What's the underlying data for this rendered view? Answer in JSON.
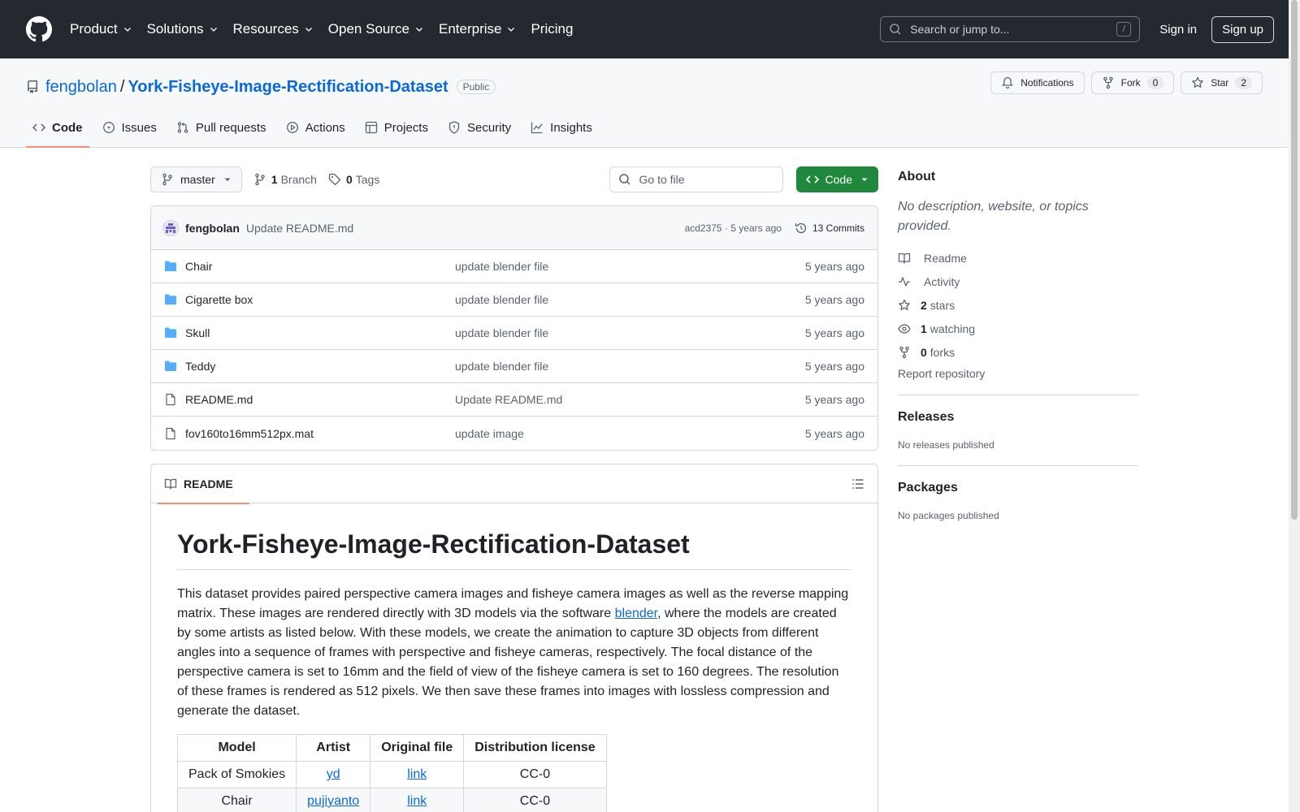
{
  "header": {
    "nav": [
      {
        "label": "Product",
        "dropdown": true
      },
      {
        "label": "Solutions",
        "dropdown": true
      },
      {
        "label": "Resources",
        "dropdown": true
      },
      {
        "label": "Open Source",
        "dropdown": true
      },
      {
        "label": "Enterprise",
        "dropdown": true
      },
      {
        "label": "Pricing",
        "dropdown": false
      }
    ],
    "search_placeholder": "Search or jump to...",
    "search_key": "/",
    "sign_in": "Sign in",
    "sign_up": "Sign up"
  },
  "repo": {
    "owner": "fengbolan",
    "separator": "/",
    "name": "York-Fisheye-Image-Rectification-Dataset",
    "visibility": "Public",
    "notifications_label": "Notifications",
    "fork_label": "Fork",
    "fork_count": "0",
    "star_label": "Star",
    "star_count": "2",
    "tabs": [
      {
        "label": "Code",
        "icon": "code-icon"
      },
      {
        "label": "Issues",
        "icon": "issue-icon"
      },
      {
        "label": "Pull requests",
        "icon": "pull-request-icon"
      },
      {
        "label": "Actions",
        "icon": "play-icon"
      },
      {
        "label": "Projects",
        "icon": "table-icon"
      },
      {
        "label": "Security",
        "icon": "shield-icon"
      },
      {
        "label": "Insights",
        "icon": "graph-icon"
      }
    ]
  },
  "toolbar": {
    "branch": "master",
    "branch_count": "1",
    "branch_label": "Branch",
    "tag_count": "0",
    "tag_label": "Tags",
    "goto_placeholder": "Go to file",
    "code_label": "Code"
  },
  "latest_commit": {
    "author": "fengbolan",
    "message": "Update README.md",
    "hash_time": "acd2375 · 5 years ago",
    "commits_label": "13 Commits"
  },
  "files": [
    {
      "type": "folder",
      "name": "Chair",
      "commit": "update blender file",
      "age": "5 years ago"
    },
    {
      "type": "folder",
      "name": "Cigarette box",
      "commit": "update blender file",
      "age": "5 years ago"
    },
    {
      "type": "folder",
      "name": "Skull",
      "commit": "update blender file",
      "age": "5 years ago"
    },
    {
      "type": "folder",
      "name": "Teddy",
      "commit": "update blender file",
      "age": "5 years ago"
    },
    {
      "type": "file",
      "name": "README.md",
      "commit": "Update README.md",
      "age": "5 years ago"
    },
    {
      "type": "file",
      "name": "fov160to16mm512px.mat",
      "commit": "update image",
      "age": "5 years ago"
    }
  ],
  "readme": {
    "tab_label": "README",
    "title": "York-Fisheye-Image-Rectification-Dataset",
    "para_before_link": "This dataset provides paired perspective camera images and fisheye camera images as well as the reverse mapping matrix. These images are rendered directly with 3D models via the software ",
    "link_text": "blender",
    "para_after_link": ", where the models are created by some artists as listed below. With these models, we create the animation to capture 3D objects from different angles into a sequence of frames with perspective and fisheye cameras, respectively. The focal distance of the perspective camera is set to 16mm and the field of view of the fisheye camera is set to 160 degrees. The resolution of these frames is rendered as 512 pixels. We then save these frames into images with lossless compression and generate the dataset.",
    "table_headers": [
      "Model",
      "Artist",
      "Original file",
      "Distribution license"
    ],
    "table_rows": [
      [
        "Pack of Smokies",
        "yd",
        "link",
        "CC-0"
      ],
      [
        "Chair",
        "pujiyanto",
        "link",
        "CC-0"
      ]
    ]
  },
  "sidebar": {
    "about_title": "About",
    "about_desc": "No description, website, or topics provided.",
    "items": [
      {
        "icon": "book-icon",
        "count": "",
        "label": "Readme"
      },
      {
        "icon": "pulse-icon",
        "count": "",
        "label": "Activity"
      },
      {
        "icon": "star-icon",
        "count": "2",
        "label": "stars"
      },
      {
        "icon": "eye-icon",
        "count": "1",
        "label": "watching"
      },
      {
        "icon": "fork-icon",
        "count": "0",
        "label": "forks"
      }
    ],
    "report": "Report repository",
    "releases_title": "Releases",
    "releases_note": "No releases published",
    "packages_title": "Packages",
    "packages_note": "No packages published"
  },
  "colors": {
    "header_bg": "#24292f",
    "link": "#0969da",
    "code_button": "#1f883d",
    "tab_underline": "#fd8c73",
    "folder": "#54aeff"
  }
}
